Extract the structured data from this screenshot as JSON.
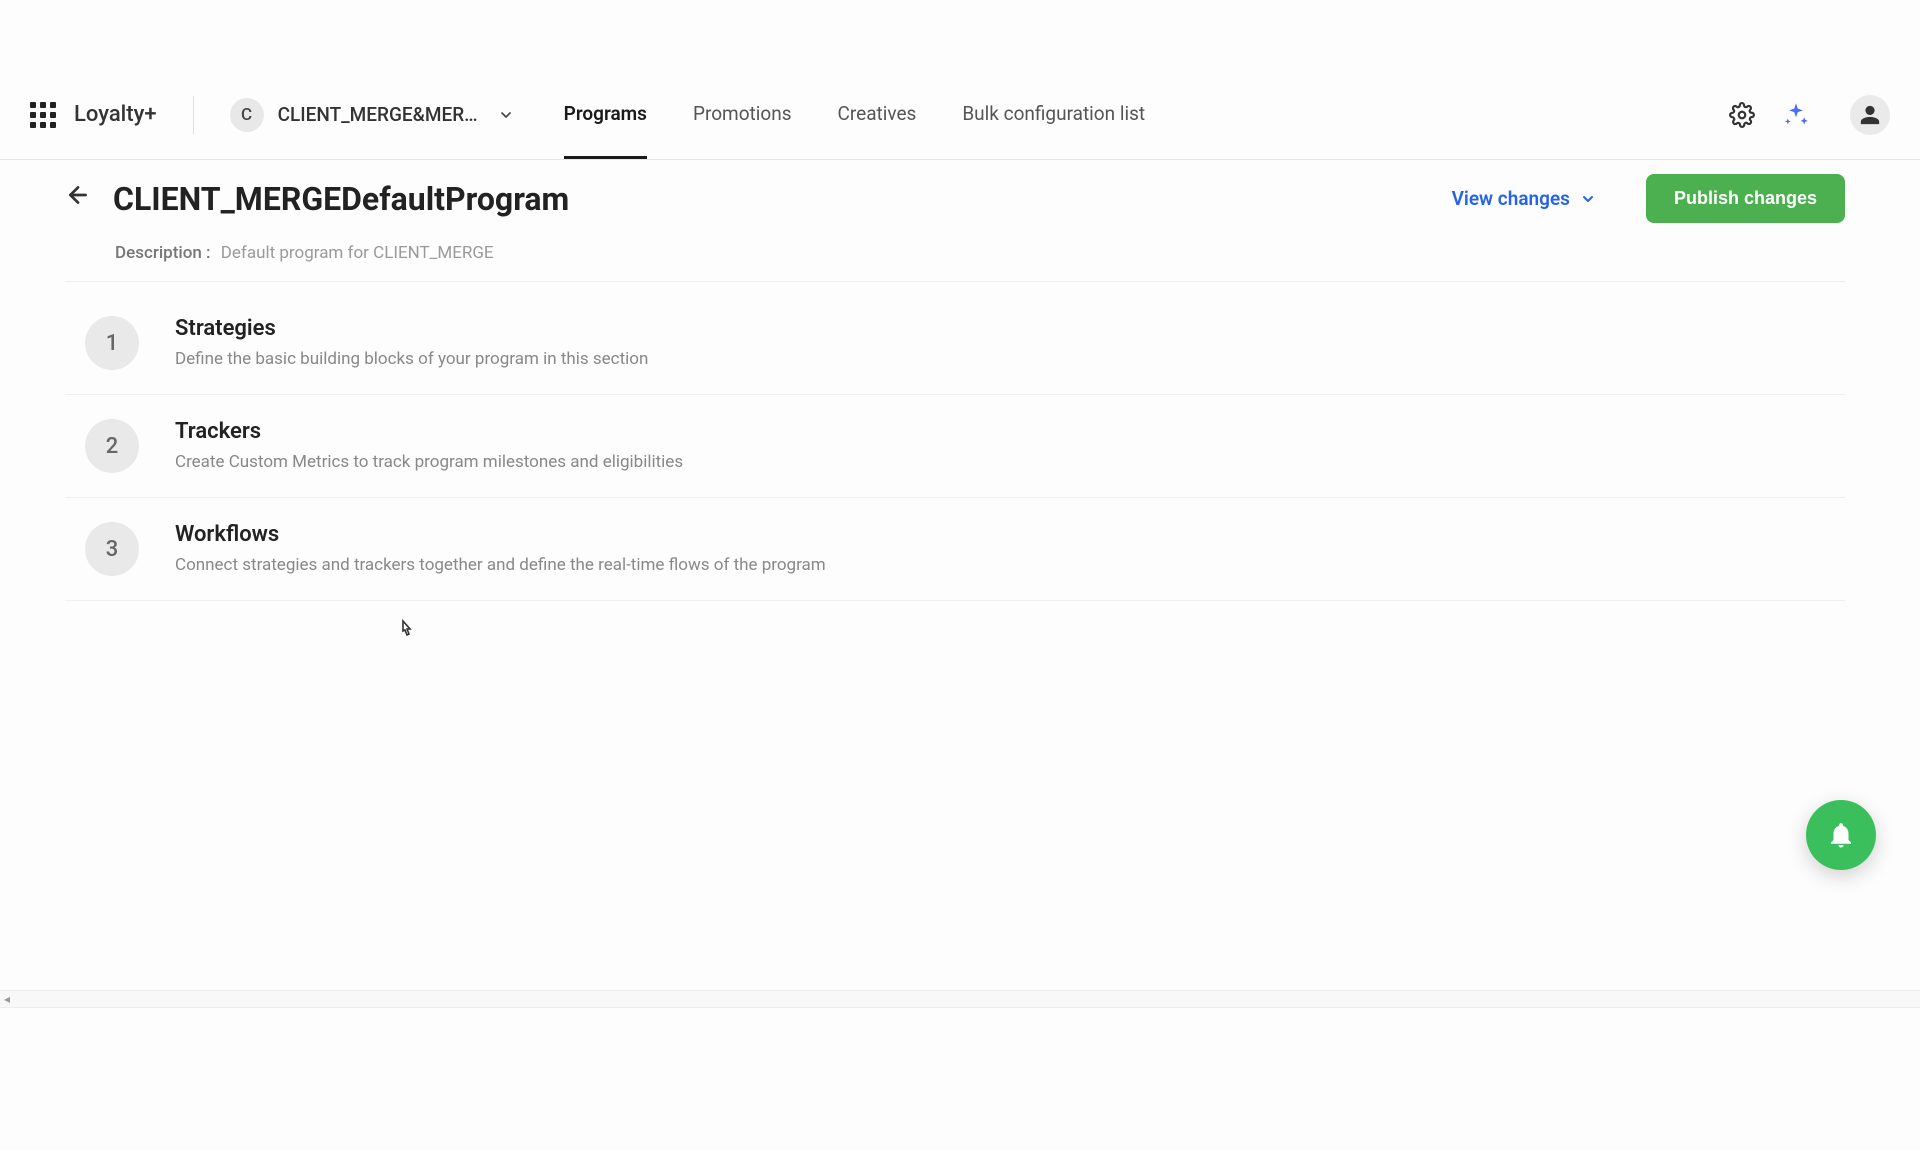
{
  "brand": "Loyalty+",
  "client": {
    "badge": "C",
    "name": "CLIENT_MERGE&MER…"
  },
  "nav": {
    "programs": "Programs",
    "promotions": "Promotions",
    "creatives": "Creatives",
    "bulk": "Bulk configuration list"
  },
  "page": {
    "title": "CLIENT_MERGEDefaultProgram",
    "view_changes": "View changes",
    "publish": "Publish changes",
    "desc_label": "Description :",
    "desc_text": "Default program for CLIENT_MERGE"
  },
  "steps": [
    {
      "num": "1",
      "title": "Strategies",
      "desc": "Define the basic building blocks of your program in this section"
    },
    {
      "num": "2",
      "title": "Trackers",
      "desc": "Create Custom Metrics to track program milestones and eligibilities"
    },
    {
      "num": "3",
      "title": "Workflows",
      "desc": "Connect strategies and trackers together and define the real-time flows of the program"
    }
  ]
}
